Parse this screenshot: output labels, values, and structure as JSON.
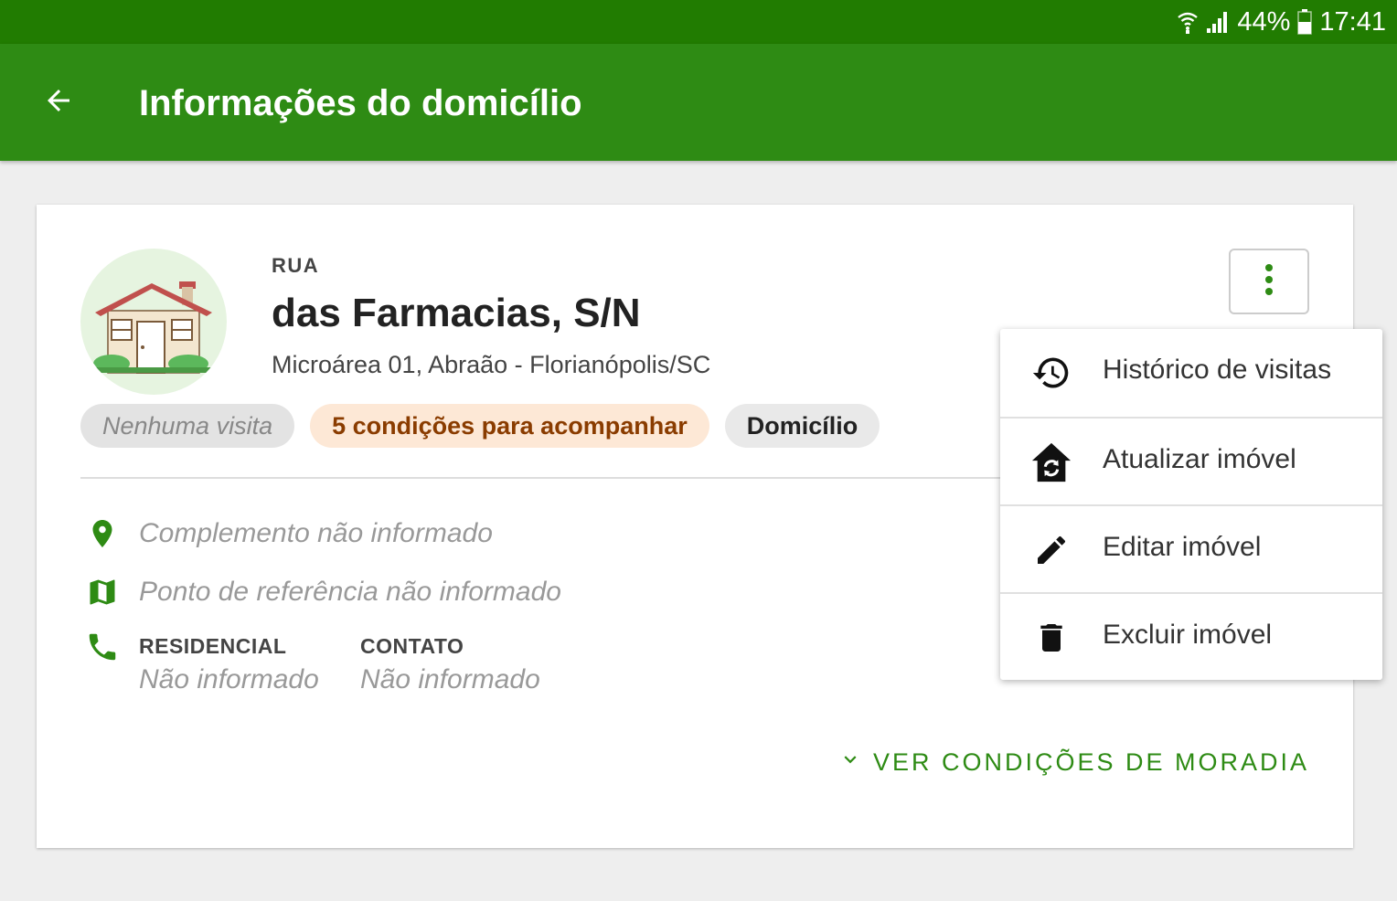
{
  "status_bar": {
    "battery": "44%",
    "time": "17:41",
    "icons": [
      "wifi-icon",
      "signal-icon",
      "battery-icon"
    ]
  },
  "app_bar": {
    "title": "Informações do domicílio",
    "back_icon": "arrow-back-icon"
  },
  "card": {
    "avatar_icon": "house-icon",
    "street_type": "RUA",
    "street_name": "das Farmacias, S/N",
    "address": "Microárea 01, Abraão - Florianópolis/SC",
    "chips": {
      "visits": "Nenhuma visita",
      "conditions": "5 condições para acompanhar",
      "type": "Domicílio"
    },
    "complement": "Complemento não informado",
    "reference": "Ponto de referência não informado",
    "phones": {
      "residential_label": "RESIDENCIAL",
      "residential_value": "Não informado",
      "contact_label": "CONTATO",
      "contact_value": "Não informado"
    },
    "see_conditions": "VER CONDIÇÕES DE MORADIA"
  },
  "menu": {
    "items": [
      {
        "label": "Histórico de visitas",
        "icon": "history-icon"
      },
      {
        "label": "Atualizar imóvel",
        "icon": "home-sync-icon"
      },
      {
        "label": "Editar imóvel",
        "icon": "pencil-icon"
      },
      {
        "label": "Excluir imóvel",
        "icon": "trash-icon"
      }
    ]
  },
  "colors": {
    "status_bar": "#217c01",
    "app_bar": "#2e8b14",
    "accent": "#2e8b14",
    "chip_orange_bg": "#fde8d6",
    "chip_orange_text": "#8a3c00"
  }
}
